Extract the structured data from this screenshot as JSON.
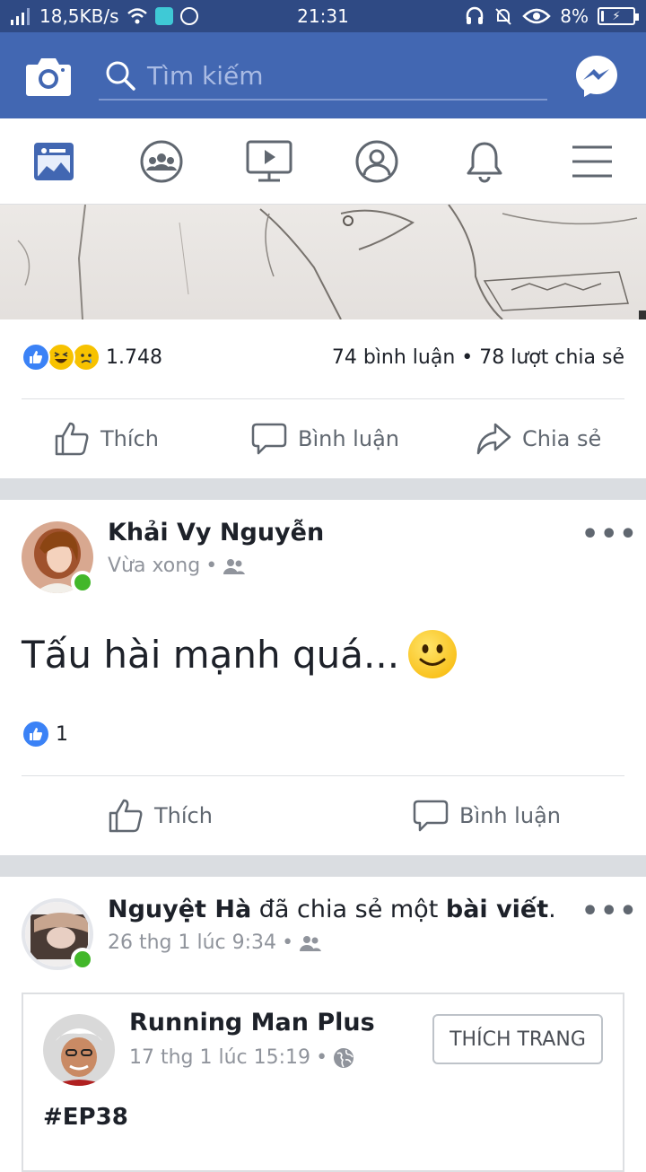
{
  "statusbar": {
    "speed": "18,5KB/s",
    "time": "21:31",
    "battery": "8%",
    "battery_level": 0.08
  },
  "topbar": {
    "search_placeholder": "Tìm kiếm"
  },
  "nav_tabs": [
    "news-feed",
    "groups",
    "watch",
    "profile",
    "notifications",
    "menu"
  ],
  "post1": {
    "reaction_count": "1.748",
    "stats": "74 bình luận • 78 lượt chia sẻ",
    "like_label": "Thích",
    "comment_label": "Bình luận",
    "share_label": "Chia sẻ"
  },
  "post2": {
    "author": "Khải Vy Nguyễn",
    "time": "Vừa xong",
    "text": "Tấu hài mạnh quá...",
    "reaction_count": "1",
    "like_label": "Thích",
    "comment_label": "Bình luận"
  },
  "post3": {
    "author": "Nguyệt Hà",
    "action_prefix": " đã chia sẻ một ",
    "action_object": "bài viết",
    "action_suffix": ".",
    "time": "26 thg 1 lúc 9:34",
    "shared": {
      "page_name": "Running Man Plus",
      "time": "17 thg 1 lúc 15:19",
      "like_page_label": "THÍCH TRANG",
      "text": "#EP38"
    }
  },
  "colors": {
    "fb_blue": "#4267b2",
    "status_bar": "#2f4a84",
    "online": "#42b72a",
    "meta_gray": "#90949c"
  }
}
